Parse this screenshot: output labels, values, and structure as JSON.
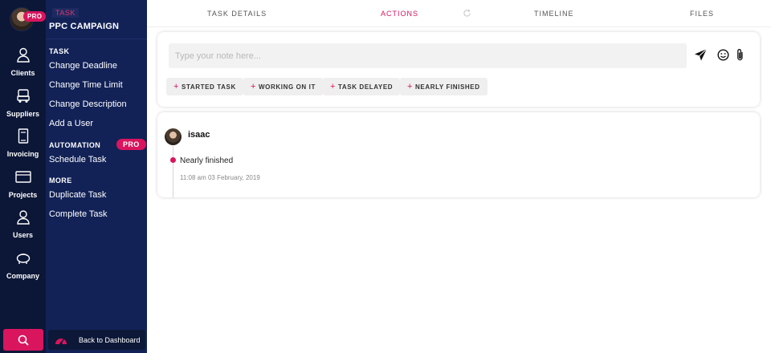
{
  "rail": {
    "pro_badge": "PRO",
    "items": [
      {
        "label": "Clients",
        "icon": "user-icon"
      },
      {
        "label": "Suppliers",
        "icon": "truck-icon"
      },
      {
        "label": "Invoicing",
        "icon": "document-icon"
      },
      {
        "label": "Projects",
        "icon": "folder-icon"
      },
      {
        "label": "Users",
        "icon": "users-icon"
      },
      {
        "label": "Company",
        "icon": "piggy-bank-icon"
      }
    ],
    "search_icon": "search-icon"
  },
  "menu": {
    "tag": "TASK",
    "title": "PPC CAMPAIGN",
    "sections": {
      "task": {
        "heading": "TASK",
        "items": [
          "Change Deadline",
          "Change Time Limit",
          "Change Description",
          "Add a User"
        ]
      },
      "automation": {
        "heading": "AUTOMATION",
        "badge": "PRO",
        "items": [
          "Schedule Task"
        ]
      },
      "more": {
        "heading": "MORE",
        "items": [
          "Duplicate Task",
          "Complete Task"
        ]
      }
    },
    "back_label": "Back to Dashboard"
  },
  "tabs": [
    {
      "label": "TASK DETAILS",
      "active": false
    },
    {
      "label": "ACTIONS",
      "active": true
    },
    {
      "label": "TIMELINE",
      "active": false
    },
    {
      "label": "FILES",
      "active": false
    }
  ],
  "note": {
    "placeholder": "Type your note here...",
    "value": "",
    "chips": [
      "STARTED TASK",
      "WORKING ON IT",
      "TASK DELAYED",
      "NEARLY FINISHED"
    ]
  },
  "post": {
    "user": "isaac",
    "status": "Nearly finished",
    "timestamp": "11:08 am 03 February, 2019"
  },
  "colors": {
    "accent": "#d9155e",
    "rail_bg": "#0c1737",
    "menu_bg": "#122257"
  }
}
